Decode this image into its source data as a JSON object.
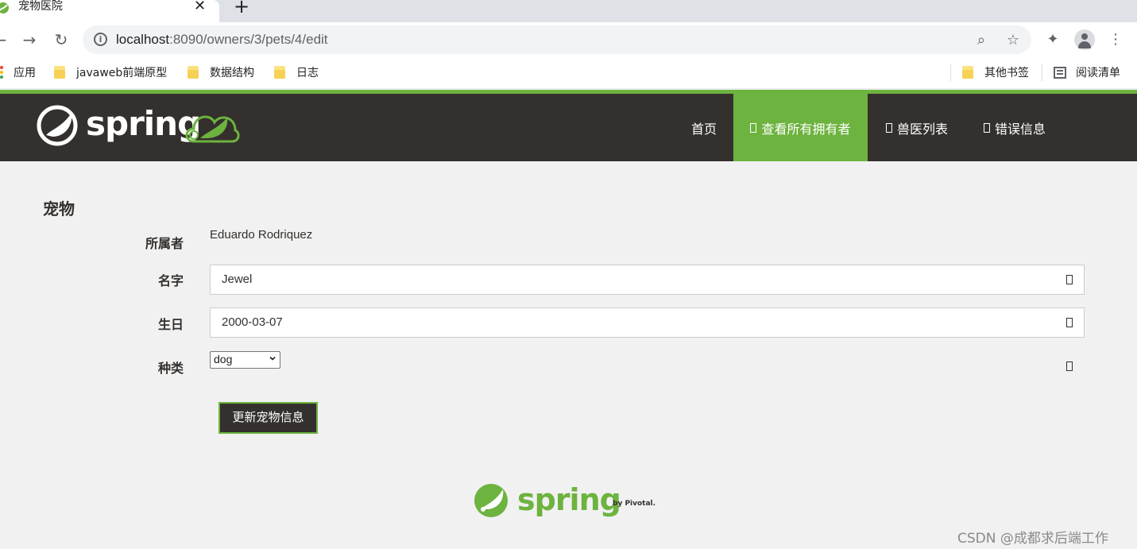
{
  "browser": {
    "tab_title": "宠物医院",
    "tab_close": "✕",
    "new_tab": "+",
    "url_host": "localhost",
    "url_rest": ":8090/owners/3/pets/4/edit",
    "back_glyph": "←",
    "forward_glyph": "→",
    "reload_glyph": "↻",
    "menu_glyph": "⋮",
    "zoom_glyph": "⌕",
    "star_glyph": "☆",
    "extension_glyph": "✦",
    "icons": [
      "back-icon",
      "forward-icon",
      "reload-icon",
      "info-icon",
      "zoom-icon",
      "star-icon",
      "extensions-icon",
      "profile-icon",
      "menu-icon"
    ]
  },
  "bookmarks": {
    "apps": "应用",
    "items": [
      "javaweb前端原型",
      "数据结构",
      "日志"
    ],
    "other": "其他书签",
    "reading_list": "阅读清单"
  },
  "colors": {
    "brand_green": "#6db33f",
    "brand_dark": "#34302d",
    "page_bg": "#f1f1f1"
  },
  "navbar": {
    "brand": "spring",
    "items": [
      {
        "label": "首页",
        "active": false,
        "icon": false
      },
      {
        "label": "查看所有拥有者",
        "active": true,
        "icon": true
      },
      {
        "label": "兽医列表",
        "active": false,
        "icon": true
      },
      {
        "label": "错误信息",
        "active": false,
        "icon": true
      }
    ]
  },
  "form": {
    "heading": "宠物",
    "owner_label": "所属者",
    "owner_value": "Eduardo Rodriquez",
    "name_label": "名字",
    "name_value": "Jewel",
    "birth_label": "生日",
    "birth_value": "2000-03-07",
    "type_label": "种类",
    "type_value": "dog",
    "submit_label": "更新宠物信息"
  },
  "footer": {
    "brand": "spring",
    "by": "by Pivotal."
  },
  "watermark": "CSDN @成都求后端工作"
}
